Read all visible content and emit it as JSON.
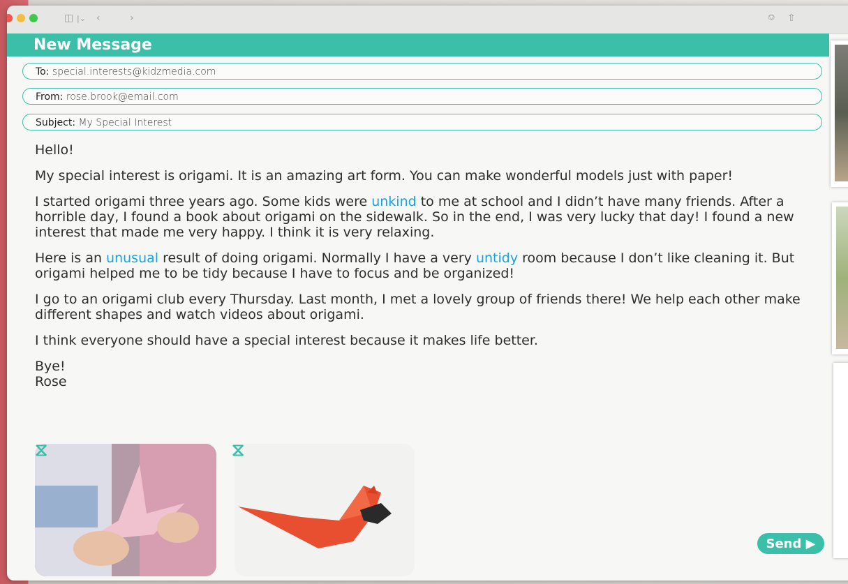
{
  "header": {
    "title": "New Message"
  },
  "fields": {
    "to_label": "To:",
    "to_value": "special.interests@kidzmedia.com",
    "from_label": "From:",
    "from_value": "rose.brook@email.com",
    "subject_label": "Subject:",
    "subject_value": "My Special Interest"
  },
  "message": {
    "greeting": "Hello!",
    "p1": "My special interest is origami. It is an amazing art form. You can make wonderful models just with paper!",
    "p2_a": "I started origami three years ago. Some kids were ",
    "p2_word": "unkind",
    "p2_b": " to me at school and I didn’t have many friends. After a horrible day, I found a book about origami on the sidewalk. So in the end, I was very lucky that day! I found a new interest that made me very happy. I think it is very relaxing.",
    "p3_a": "Here is an ",
    "p3_word1": "unusual",
    "p3_b": " result of doing origami. Normally I have a very ",
    "p3_word2": "untidy",
    "p3_c": " room because I don’t like cleaning it. But origami helped me to be tidy because I have to focus and be organized!",
    "p4": "I go to an origami club every Thursday. Last month, I met a lovely group of friends there! We help each other make different shapes and watch videos about origami.",
    "p5": "I think everyone should have a special interest because it makes life better.",
    "signoff": "Bye!",
    "signature": "Rose"
  },
  "buttons": {
    "send": "Send ▶"
  },
  "colors": {
    "accent": "#3cbfa8",
    "highlight": "#1aa3d9"
  },
  "icons": [
    "sidebar-icon",
    "chevron-left-icon",
    "chevron-right-icon",
    "download-icon",
    "share-icon",
    "paperclip-icon"
  ]
}
